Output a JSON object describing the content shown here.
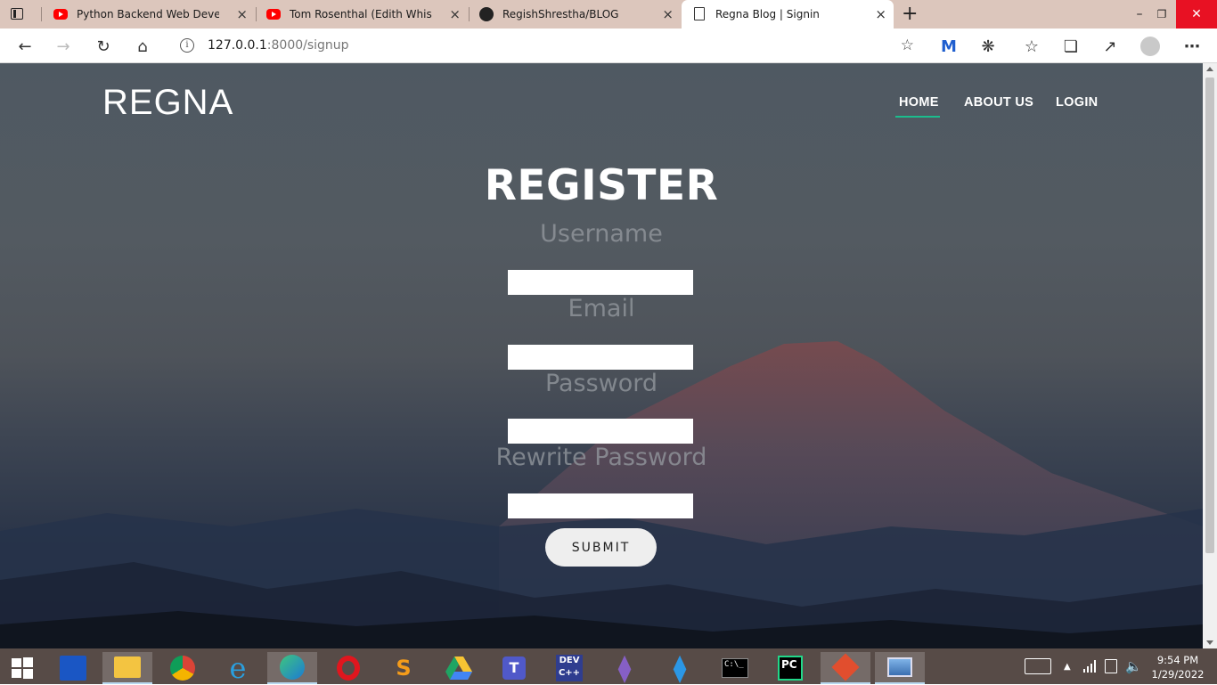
{
  "browser": {
    "tabs": [
      {
        "title": "Python Backend Web Developme",
        "favicon": "youtube-icon"
      },
      {
        "title": "Tom Rosenthal (Edith Whiskers) -",
        "favicon": "youtube-icon"
      },
      {
        "title": "RegishShrestha/BLOG",
        "favicon": "github-icon"
      },
      {
        "title": "Regna Blog | Signin",
        "favicon": "document-icon",
        "active": true
      }
    ],
    "address": {
      "host": "127.0.0.1",
      "path": ":8000/signup"
    },
    "tab_close": "×",
    "new_tab": "+"
  },
  "site": {
    "logo": "REGNA",
    "nav": {
      "home": "HOME",
      "about": "ABOUT US",
      "login": "LOGIN"
    },
    "accent": "#1bbd8d"
  },
  "form": {
    "title": "REGISTER",
    "username_label": "Username",
    "email_label": "Email",
    "password_label": "Password",
    "rewrite_label": "Rewrite Password",
    "submit_label": "SUBMIT"
  },
  "taskbar": {
    "time": "9:54 PM",
    "date": "1/29/2022"
  }
}
